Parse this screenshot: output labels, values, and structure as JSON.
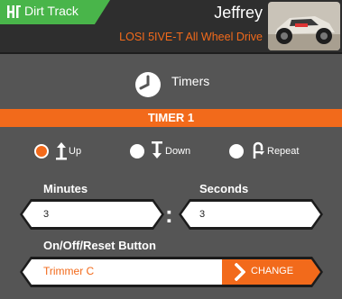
{
  "header": {
    "track_name": "Dirt Track",
    "model_name": "Jeffrey",
    "model_description": "LOSI 5IVE-T All Wheel Drive"
  },
  "screen": {
    "title": "Timers",
    "section_bar": "TIMER 1"
  },
  "direction": {
    "options": [
      {
        "label": "Up",
        "selected": true,
        "icon": "arrow-up-icon"
      },
      {
        "label": "Down",
        "selected": false,
        "icon": "arrow-down-icon"
      },
      {
        "label": "Repeat",
        "selected": false,
        "icon": "repeat-icon"
      }
    ]
  },
  "time": {
    "minutes_label": "Minutes",
    "minutes_value": "3",
    "separator": ":",
    "seconds_label": "Seconds",
    "seconds_value": "3"
  },
  "button_assign": {
    "label": "On/Off/Reset Button",
    "value": "Trimmer C",
    "change_label": "CHANGE"
  },
  "colors": {
    "accent": "#f26a1b",
    "track_green": "#49b54a",
    "panel": "#555555"
  }
}
